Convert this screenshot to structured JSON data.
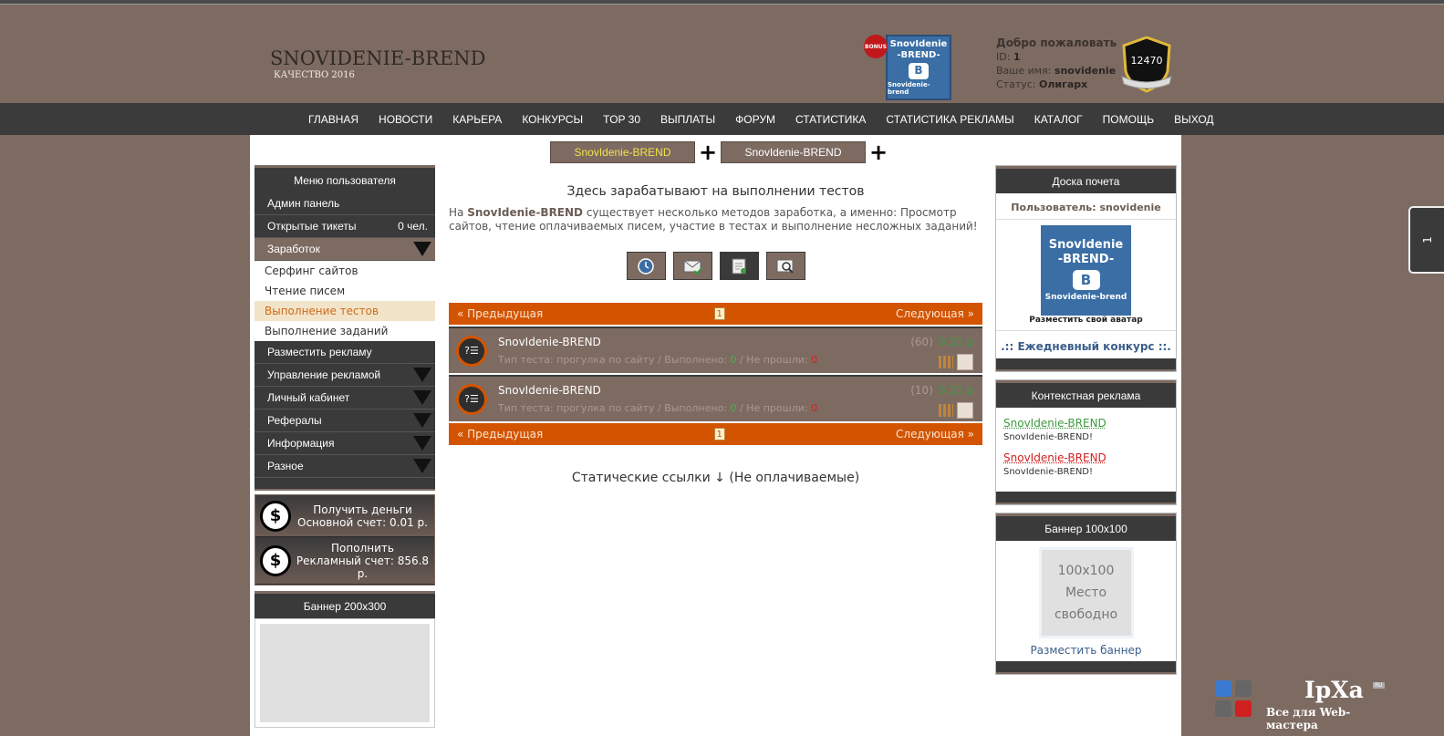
{
  "header": {
    "site_title": "SNOVIDENIE-BREND",
    "site_subtitle": "КАЧЕСТВО 2016",
    "bonus_badge": "BONUS",
    "avatar_text": [
      "SnovIdenie",
      "-BREND-",
      "B",
      "Snovidenie-brend"
    ],
    "welcome_title": "Добро пожаловать",
    "id_label": "ID:",
    "id_value": "1",
    "name_label": "Ваше имя:",
    "name_value": "snovidenie",
    "status_label": "Статус:",
    "status_value": "Олигарх",
    "shield_value": "12470"
  },
  "nav": [
    "ГЛАВНАЯ",
    "НОВОСТИ",
    "КАРЬЕРА",
    "КОНКУРСЫ",
    "TOP 30",
    "ВЫПЛАТЫ",
    "ФОРУМ",
    "СТАТИСТИКА",
    "СТАТИСТИКА РЕКЛАМЫ",
    "КАТАЛОГ",
    "ПОМОЩЬ",
    "ВЫХОД"
  ],
  "tabs": [
    "SnovIdenie-BREND",
    "SnovIdenie-BREND"
  ],
  "user_menu": {
    "title": "Меню пользователя",
    "admin": "Админ панель",
    "tickets": "Открытые тикеты",
    "tickets_count": "0 чел.",
    "earnings": "Заработок",
    "earn_items": [
      "Серфинг сайтов",
      "Чтение писем",
      "Выполнение тестов",
      "Выполнение заданий"
    ],
    "place_ad": "Разместить рекламу",
    "groups": [
      "Управление рекламой",
      "Личный кабинет",
      "Рефералы",
      "Информация",
      "Разное"
    ]
  },
  "money": {
    "get_label": "Получить деньги",
    "main_balance": "Основной счет: 0.01 р.",
    "topup_label": "Пополнить",
    "ad_balance": "Рекламный счет: 856.8 р.",
    "dollar": "$"
  },
  "banner200": {
    "title": "Баннер 200x300"
  },
  "content": {
    "title": "Здесь зарабатывают на выполнении тестов",
    "desc_prefix": "На ",
    "desc_brand": "SnovIdenie-BREND",
    "desc_rest": " существует несколько методов заработка, а именно: Просмотр сайтов, чтение оплачиваемых писем, участие в тестах и выполнение несложных заданий!",
    "prev": "« Предыдущая",
    "page": "1",
    "next": "Следующая »",
    "static_links": "Статические ссылки ↓ (Не оплачиваемые)"
  },
  "tasks": [
    {
      "name": "SnovIdenie-BREND",
      "type_label": "Тип теста: прогулка по сайту / Выполнено:",
      "done": "0",
      "failed_label": "/ Не прошли:",
      "failed": "0",
      "count": "(60)",
      "price": "0.20 р"
    },
    {
      "name": "SnovIdenie-BREND",
      "type_label": "Тип теста: прогулка по сайту / Выполнено:",
      "done": "0",
      "failed_label": "/ Не прошли:",
      "failed": "0",
      "count": "(10)",
      "price": "0.20 р"
    }
  ],
  "honor": {
    "title": "Доска почета",
    "user": "Пользователь: snovidenie",
    "avatar_text": [
      "SnovIdenie",
      "-BREND-",
      "B",
      "Snovidenie-brend"
    ],
    "place_avatar": "Разместить свой аватар",
    "contest": ".:: Ежедневный конкурс ::."
  },
  "context_ads": {
    "title": "Контекстная реклама",
    "ads": [
      {
        "link": "SnovIdenie-BREND",
        "desc": "SnovIdenie-BREND!"
      },
      {
        "link": "SnovIdenie-BREND",
        "desc": "SnovIdenie-BREND!"
      }
    ]
  },
  "banner100": {
    "title": "Баннер 100x100",
    "line1": "100x100",
    "line2": "Место",
    "line3": "свободно",
    "link": "Разместить баннер"
  },
  "side_tab": "1",
  "watermark": {
    "brand": "IpXa",
    "ru": "RU",
    "tagline": "Все для Web-мастера"
  },
  "colors": {
    "accent": "#d35400",
    "brown": "#7d6b62",
    "dark": "#3a3a3a",
    "green": "#3d9b3d",
    "red": "#d42020"
  }
}
